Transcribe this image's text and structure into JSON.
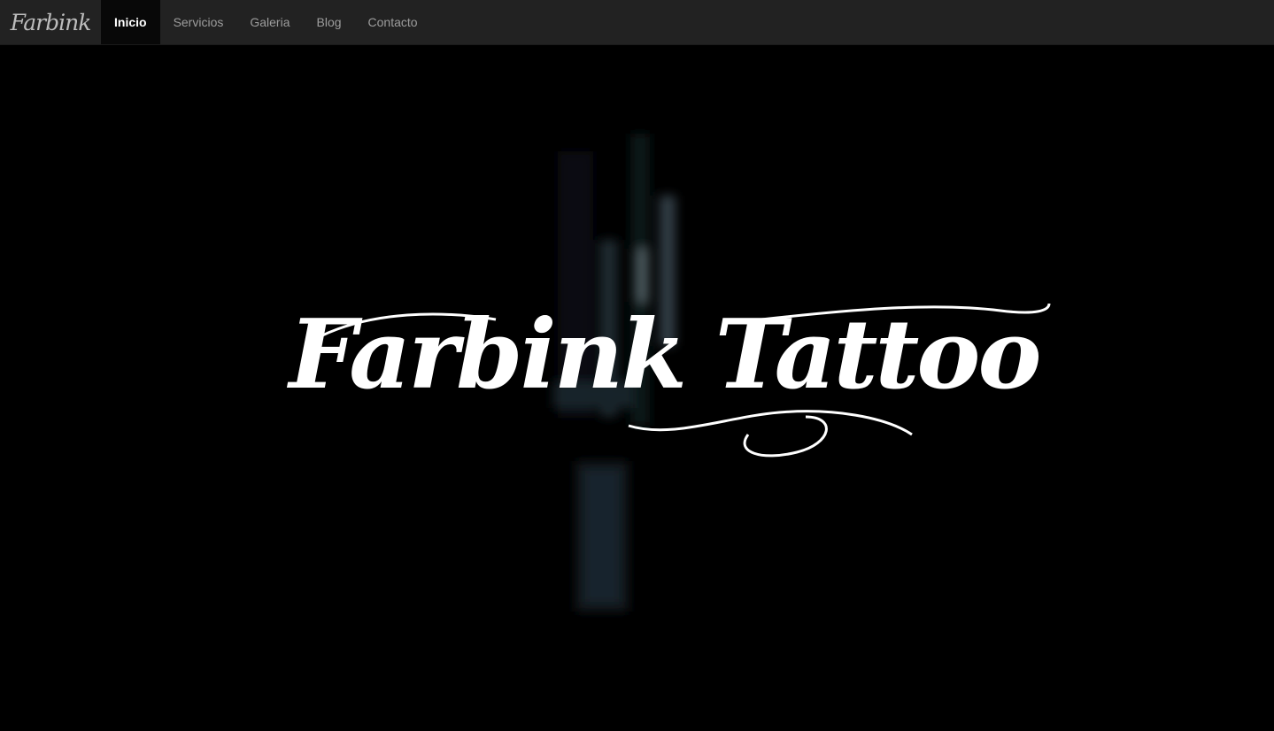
{
  "navbar": {
    "brand": "Farbink",
    "items": [
      {
        "label": "Inicio",
        "active": true
      },
      {
        "label": "Servicios",
        "active": false
      },
      {
        "label": "Galeria",
        "active": false
      },
      {
        "label": "Blog",
        "active": false
      },
      {
        "label": "Contacto",
        "active": false
      }
    ]
  },
  "hero": {
    "title": "Farbink Tattoo",
    "background_icon": "tattoo-machine-icon"
  },
  "colors": {
    "navbar_bg": "#222222",
    "active_item_bg": "#080808",
    "page_bg": "#000000",
    "text_muted": "#9d9d9d",
    "text_active": "#ffffff"
  }
}
